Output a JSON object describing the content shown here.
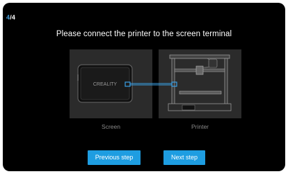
{
  "step": {
    "current": "4",
    "separator": "/",
    "total": "4"
  },
  "title": "Please connect the printer to the screen terminal",
  "panels": {
    "screen": {
      "caption": "Screen",
      "device_logo": "CREALITY"
    },
    "printer": {
      "caption": "Printer"
    }
  },
  "buttons": {
    "previous": "Previous step",
    "next": "Next step"
  },
  "colors": {
    "accent": "#1e9de1",
    "step_current": "#4aa3e0",
    "panel_bg": "#2b2b2b",
    "caption": "#8a8a8a"
  }
}
